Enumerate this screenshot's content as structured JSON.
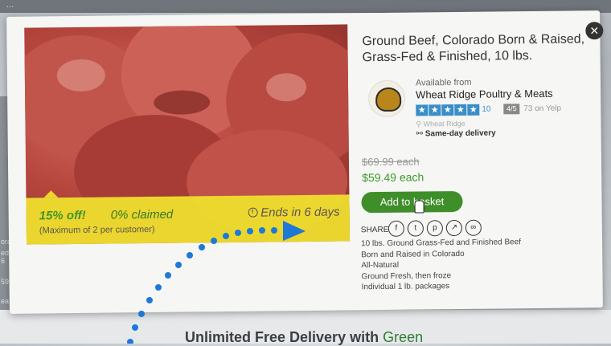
{
  "backdrop": {
    "top_text": "...",
    "left_fragments": [
      "orac",
      "ed 6",
      "59.4",
      "ea"
    ],
    "promo_bold": "Unlimited Free Delivery with",
    "promo_green": "Green"
  },
  "modal": {
    "close_glyph": "✕",
    "title": "Ground Beef, Colorado Born & Raised, Grass-Fed & Finished, 10 lbs.",
    "vendor": {
      "available_label": "Available from",
      "name": "Wheat Ridge Poultry & Meats",
      "rating_stars": 5,
      "review_count": "10",
      "yelp_badge": "4/5",
      "yelp_text": "73 on Yelp",
      "location": "Wheat Ridge",
      "delivery": "Same-day delivery"
    },
    "deal": {
      "discount": "15% off!",
      "claimed": "0% claimed",
      "limit": "(Maximum of 2 per customer)",
      "ends": "Ends in 6 days"
    },
    "pricing": {
      "old_price": "$69.99 each",
      "new_price": "$59.49 each"
    },
    "basket_button": "Add to basket",
    "share_label": "SHARE",
    "share_icons": [
      "facebook-icon",
      "twitter-icon",
      "pinterest-icon",
      "external-link-icon",
      "link-icon"
    ],
    "description": [
      "10 lbs. Ground Grass-Fed and Finished Beef",
      "Born and Raised in Colorado",
      "All-Natural",
      "Ground Fresh, then froze",
      "Individual 1 lb. packages"
    ]
  },
  "colors": {
    "accent_green": "#3e8f2a",
    "deal_yellow": "#f0e22e",
    "star_blue": "#3a8ec8",
    "annotation_blue": "#1e78d6"
  }
}
